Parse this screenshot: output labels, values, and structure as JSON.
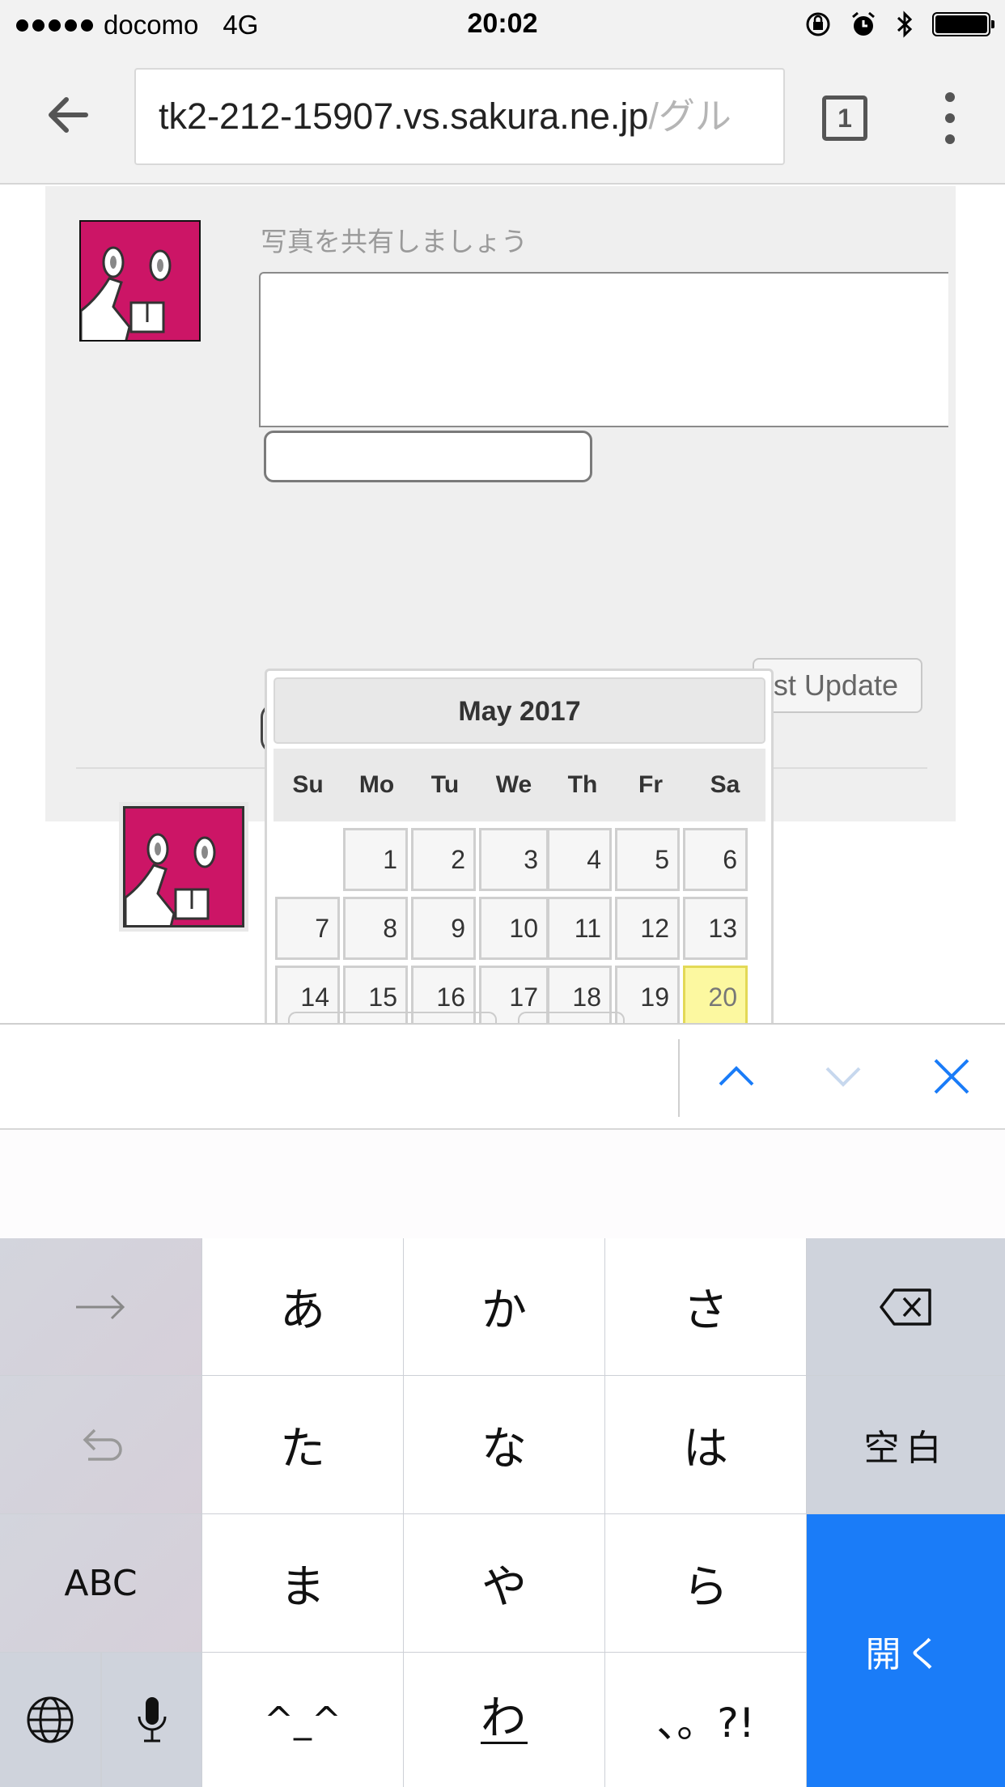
{
  "status_bar": {
    "carrier": "docomo",
    "network": "4G",
    "time": "20:02",
    "signal_bars": 5,
    "battery_level": 1.0
  },
  "browser": {
    "url_host": "tk2-212-15907.vs.sakura.ne.jp",
    "url_path": "/グル",
    "tab_count": "1",
    "icons": [
      "back-arrow-icon",
      "tabs-icon",
      "more-menu-icon"
    ]
  },
  "post_form": {
    "placeholder": "写真を共有しましょう",
    "date_value": "",
    "post_button_label": "st Update"
  },
  "datepicker": {
    "title": "May 2017",
    "weekdays": [
      "Su",
      "Mo",
      "Tu",
      "We",
      "Th",
      "Fr",
      "Sa"
    ],
    "first_weekday_index": 1,
    "days_in_month": 31,
    "today": 20,
    "today_color": "#fcf8a0"
  },
  "find_bar": {
    "icons": [
      "chevron-up-icon",
      "chevron-down-icon",
      "close-icon"
    ],
    "accent_color": "#1a7cf8"
  },
  "keyboard": {
    "rows": [
      [
        "→",
        "あ",
        "か",
        "さ",
        "⌫"
      ],
      [
        "↺",
        "た",
        "な",
        "は",
        "空白"
      ],
      [
        "ABC",
        "ま",
        "や",
        "ら",
        "開く"
      ],
      [
        "🌐",
        "🎤",
        "^_^",
        "わ_",
        "、。?!"
      ]
    ],
    "labels": {
      "r1c1": "あ",
      "r1c2": "か",
      "r1c3": "さ",
      "r2c1": "た",
      "r2c2": "な",
      "r2c3": "は",
      "space": "空白",
      "abc": "ABC",
      "r3c1": "ま",
      "r3c2": "や",
      "r3c3": "ら",
      "return": "開く",
      "emoticon": "^_^",
      "wa": "わ",
      "punct": "、。?!"
    },
    "return_color": "#1a7cf8"
  }
}
